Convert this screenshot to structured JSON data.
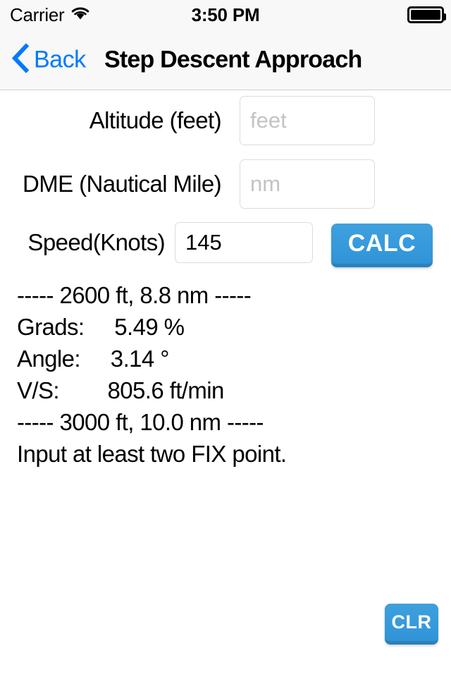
{
  "status_bar": {
    "carrier": "Carrier",
    "wifi_icon": "wifi-icon",
    "time": "3:50 PM",
    "battery_icon": "battery-full-icon"
  },
  "nav_bar": {
    "back_icon": "chevron-left-icon",
    "back_label": "Back",
    "title": "Step Descent Approach"
  },
  "form": {
    "altitude": {
      "label": "Altitude (feet)",
      "placeholder": "feet",
      "value": ""
    },
    "dme": {
      "label": "DME (Nautical Mile)",
      "placeholder": "nm",
      "value": ""
    },
    "speed": {
      "label": "Speed(Knots)",
      "placeholder": "",
      "value": "145"
    },
    "calc_button": "CALC"
  },
  "results": {
    "lines": [
      "----- 2600 ft, 8.8 nm -----",
      "Grads:     5.49 %",
      "Angle:     3.14 °",
      "V/S:        805.6 ft/min",
      "----- 3000 ft, 10.0 nm -----",
      "Input at least two FIX point."
    ]
  },
  "footer": {
    "clear_button": "CLR"
  },
  "colors": {
    "accent_blue": "#3498db",
    "link_blue": "#007aff",
    "nav_background": "#f8f8f8",
    "input_border": "#dcdcdc",
    "placeholder": "#c3c3c7"
  }
}
